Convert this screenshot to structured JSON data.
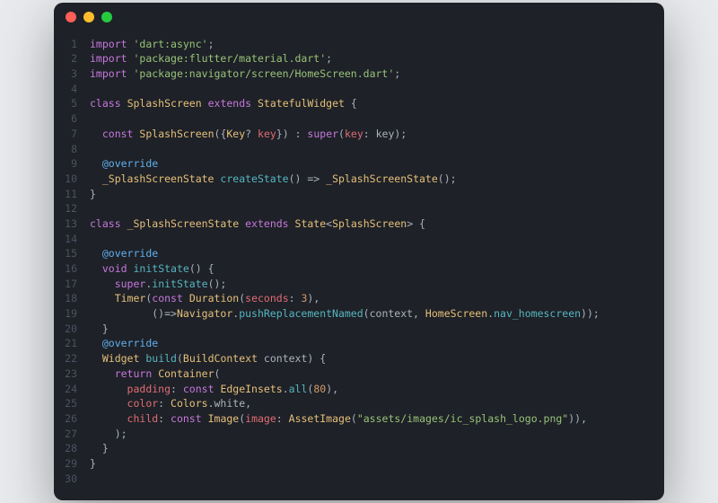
{
  "window": {
    "traffic_lights": [
      "close",
      "minimize",
      "zoom"
    ]
  },
  "editor": {
    "line_numbers": [
      "1",
      "2",
      "3",
      "4",
      "5",
      "6",
      "7",
      "8",
      "9",
      "10",
      "11",
      "12",
      "13",
      "14",
      "15",
      "16",
      "17",
      "18",
      "19",
      "20",
      "21",
      "22",
      "23",
      "24",
      "25",
      "26",
      "27",
      "28",
      "29",
      "30"
    ],
    "lines": [
      [
        {
          "c": "kw",
          "t": "import"
        },
        {
          "c": "op",
          "t": " "
        },
        {
          "c": "str",
          "t": "'dart:async'"
        },
        {
          "c": "op",
          "t": ";"
        }
      ],
      [
        {
          "c": "kw",
          "t": "import"
        },
        {
          "c": "op",
          "t": " "
        },
        {
          "c": "str",
          "t": "'package:flutter/material.dart'"
        },
        {
          "c": "op",
          "t": ";"
        }
      ],
      [
        {
          "c": "kw",
          "t": "import"
        },
        {
          "c": "op",
          "t": " "
        },
        {
          "c": "str",
          "t": "'package:navigator/screen/HomeScreen.dart'"
        },
        {
          "c": "op",
          "t": ";"
        }
      ],
      [],
      [
        {
          "c": "kw",
          "t": "class"
        },
        {
          "c": "op",
          "t": " "
        },
        {
          "c": "type",
          "t": "SplashScreen"
        },
        {
          "c": "op",
          "t": " "
        },
        {
          "c": "kw",
          "t": "extends"
        },
        {
          "c": "op",
          "t": " "
        },
        {
          "c": "type",
          "t": "StatefulWidget"
        },
        {
          "c": "op",
          "t": " {"
        }
      ],
      [],
      [
        {
          "c": "op",
          "t": "  "
        },
        {
          "c": "kw",
          "t": "const"
        },
        {
          "c": "op",
          "t": " "
        },
        {
          "c": "type",
          "t": "SplashScreen"
        },
        {
          "c": "op",
          "t": "({"
        },
        {
          "c": "type",
          "t": "Key"
        },
        {
          "c": "op",
          "t": "? "
        },
        {
          "c": "var",
          "t": "key"
        },
        {
          "c": "op",
          "t": "}) : "
        },
        {
          "c": "kw",
          "t": "super"
        },
        {
          "c": "op",
          "t": "("
        },
        {
          "c": "var",
          "t": "key"
        },
        {
          "c": "op",
          "t": ": key);"
        }
      ],
      [],
      [
        {
          "c": "op",
          "t": "  "
        },
        {
          "c": "meta",
          "t": "@override"
        }
      ],
      [
        {
          "c": "op",
          "t": "  "
        },
        {
          "c": "type",
          "t": "_SplashScreenState"
        },
        {
          "c": "op",
          "t": " "
        },
        {
          "c": "fn",
          "t": "createState"
        },
        {
          "c": "op",
          "t": "() => "
        },
        {
          "c": "type",
          "t": "_SplashScreenState"
        },
        {
          "c": "op",
          "t": "();"
        }
      ],
      [
        {
          "c": "op",
          "t": "}"
        }
      ],
      [],
      [
        {
          "c": "kw",
          "t": "class"
        },
        {
          "c": "op",
          "t": " "
        },
        {
          "c": "type",
          "t": "_SplashScreenState"
        },
        {
          "c": "op",
          "t": " "
        },
        {
          "c": "kw",
          "t": "extends"
        },
        {
          "c": "op",
          "t": " "
        },
        {
          "c": "type",
          "t": "State"
        },
        {
          "c": "op",
          "t": "<"
        },
        {
          "c": "type",
          "t": "SplashScreen"
        },
        {
          "c": "op",
          "t": "> {"
        }
      ],
      [],
      [
        {
          "c": "op",
          "t": "  "
        },
        {
          "c": "meta",
          "t": "@override"
        }
      ],
      [
        {
          "c": "op",
          "t": "  "
        },
        {
          "c": "kw",
          "t": "void"
        },
        {
          "c": "op",
          "t": " "
        },
        {
          "c": "fn",
          "t": "initState"
        },
        {
          "c": "op",
          "t": "() {"
        }
      ],
      [
        {
          "c": "op",
          "t": "    "
        },
        {
          "c": "kw",
          "t": "super"
        },
        {
          "c": "op",
          "t": "."
        },
        {
          "c": "fn",
          "t": "initState"
        },
        {
          "c": "op",
          "t": "();"
        }
      ],
      [
        {
          "c": "op",
          "t": "    "
        },
        {
          "c": "type",
          "t": "Timer"
        },
        {
          "c": "op",
          "t": "("
        },
        {
          "c": "kw",
          "t": "const"
        },
        {
          "c": "op",
          "t": " "
        },
        {
          "c": "type",
          "t": "Duration"
        },
        {
          "c": "op",
          "t": "("
        },
        {
          "c": "var",
          "t": "seconds"
        },
        {
          "c": "op",
          "t": ": "
        },
        {
          "c": "num",
          "t": "3"
        },
        {
          "c": "op",
          "t": "),"
        }
      ],
      [
        {
          "c": "op",
          "t": "          ()=>"
        },
        {
          "c": "type",
          "t": "Navigator"
        },
        {
          "c": "op",
          "t": "."
        },
        {
          "c": "fn",
          "t": "pushReplacementNamed"
        },
        {
          "c": "op",
          "t": "(context, "
        },
        {
          "c": "type",
          "t": "HomeScreen"
        },
        {
          "c": "op",
          "t": "."
        },
        {
          "c": "navc",
          "t": "nav_homescreen"
        },
        {
          "c": "op",
          "t": "));"
        }
      ],
      [
        {
          "c": "op",
          "t": "  }"
        }
      ],
      [
        {
          "c": "op",
          "t": "  "
        },
        {
          "c": "meta",
          "t": "@override"
        }
      ],
      [
        {
          "c": "op",
          "t": "  "
        },
        {
          "c": "type",
          "t": "Widget"
        },
        {
          "c": "op",
          "t": " "
        },
        {
          "c": "fn",
          "t": "build"
        },
        {
          "c": "op",
          "t": "("
        },
        {
          "c": "type",
          "t": "BuildContext"
        },
        {
          "c": "op",
          "t": " context) {"
        }
      ],
      [
        {
          "c": "op",
          "t": "    "
        },
        {
          "c": "kw",
          "t": "return"
        },
        {
          "c": "op",
          "t": " "
        },
        {
          "c": "type",
          "t": "Container"
        },
        {
          "c": "op",
          "t": "("
        }
      ],
      [
        {
          "c": "op",
          "t": "      "
        },
        {
          "c": "var",
          "t": "padding"
        },
        {
          "c": "op",
          "t": ": "
        },
        {
          "c": "kw",
          "t": "const"
        },
        {
          "c": "op",
          "t": " "
        },
        {
          "c": "type",
          "t": "EdgeInsets"
        },
        {
          "c": "op",
          "t": "."
        },
        {
          "c": "fn",
          "t": "all"
        },
        {
          "c": "op",
          "t": "("
        },
        {
          "c": "num",
          "t": "80"
        },
        {
          "c": "op",
          "t": "),"
        }
      ],
      [
        {
          "c": "op",
          "t": "      "
        },
        {
          "c": "var",
          "t": "color"
        },
        {
          "c": "op",
          "t": ": "
        },
        {
          "c": "type",
          "t": "Colors"
        },
        {
          "c": "op",
          "t": ".white,"
        }
      ],
      [
        {
          "c": "op",
          "t": "      "
        },
        {
          "c": "var",
          "t": "child"
        },
        {
          "c": "op",
          "t": ": "
        },
        {
          "c": "kw",
          "t": "const"
        },
        {
          "c": "op",
          "t": " "
        },
        {
          "c": "type",
          "t": "Image"
        },
        {
          "c": "op",
          "t": "("
        },
        {
          "c": "var",
          "t": "image"
        },
        {
          "c": "op",
          "t": ": "
        },
        {
          "c": "type",
          "t": "AssetImage"
        },
        {
          "c": "op",
          "t": "("
        },
        {
          "c": "str",
          "t": "\"assets/images/ic_splash_logo.png\""
        },
        {
          "c": "op",
          "t": ")),"
        }
      ],
      [
        {
          "c": "op",
          "t": "    );"
        }
      ],
      [
        {
          "c": "op",
          "t": "  }"
        }
      ],
      [
        {
          "c": "op",
          "t": "}"
        }
      ],
      []
    ]
  }
}
